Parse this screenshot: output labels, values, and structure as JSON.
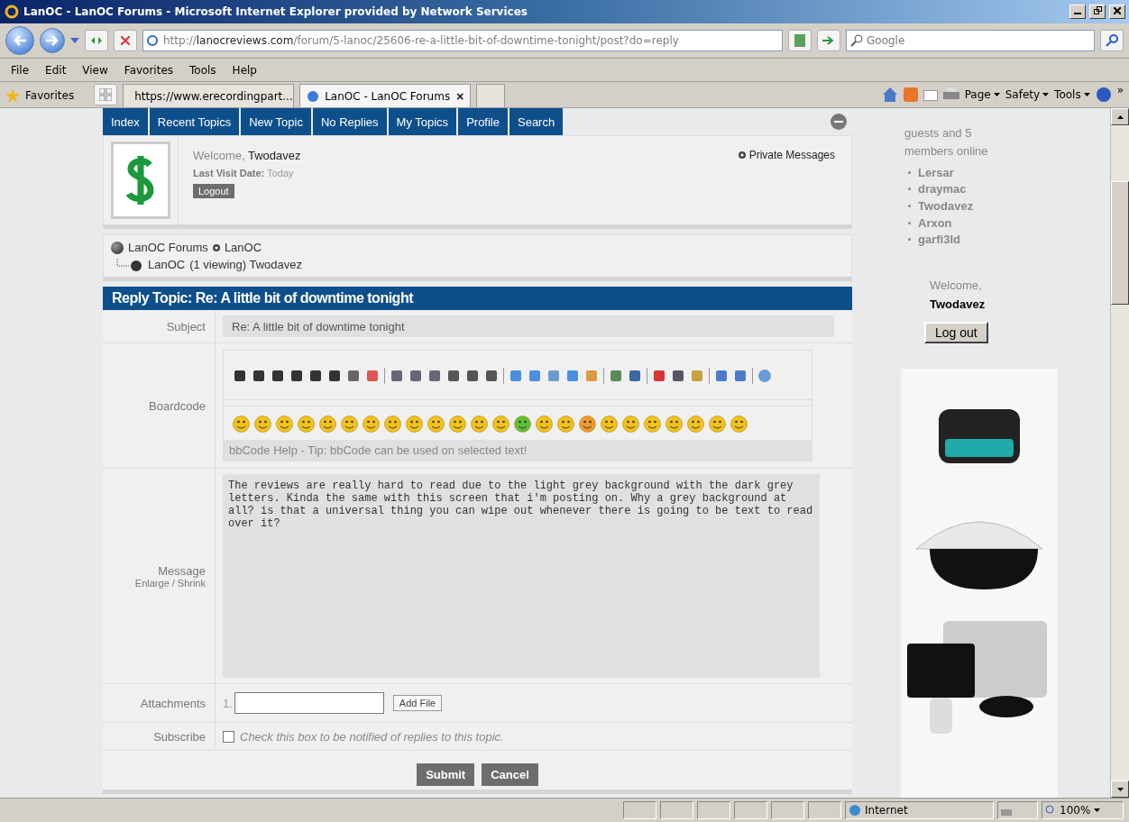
{
  "window": {
    "title": "LanOC - LanOC Forums - Microsoft Internet Explorer provided by Network Services"
  },
  "address_bar": {
    "url_prefix": "http://",
    "url_host": "lanocreviews.com",
    "url_path": "/forum/5-lanoc/25606-re-a-little-bit-of-downtime-tonight/post?do=reply",
    "search_placeholder": "Google"
  },
  "menu": [
    "File",
    "Edit",
    "View",
    "Favorites",
    "Tools",
    "Help"
  ],
  "favorites_bar": {
    "label": "Favorites",
    "tabs": [
      {
        "label": "https://www.erecordingpart...",
        "selected": false
      },
      {
        "label": "LanOC - LanOC Forums",
        "selected": true
      }
    ],
    "close": "×",
    "commands": [
      "Page",
      "Safety",
      "Tools"
    ],
    "more": "»"
  },
  "forum_nav": [
    {
      "label": "Index"
    },
    {
      "label": "Recent Topics"
    },
    {
      "label": "New Topic"
    },
    {
      "label": "No Replies"
    },
    {
      "label": "My Topics"
    },
    {
      "label": "Profile"
    },
    {
      "label": "Search"
    }
  ],
  "user_panel": {
    "welcome": "Welcome,",
    "user": "Twodavez",
    "last_visit_label": "Last Visit Date:",
    "last_visit": "Today",
    "logout": "Logout",
    "private_messages": "Private Messages"
  },
  "breadcrumb": {
    "root": "LanOC Forums",
    "section": "LanOC",
    "current": "LanOC",
    "viewing": "(1 viewing)",
    "viewer": "Twodavez"
  },
  "reply_form": {
    "title": "Reply Topic: Re: A little bit of downtime tonight",
    "subject_label": "Subject",
    "subject_value": "Re: A little bit of downtime tonight",
    "boardcode_label": "Boardcode",
    "help_tip": "bbCode Help - Tip: bbCode can be used on selected text!",
    "message_label": "Message",
    "enlarge": "Enlarge",
    "separator": "/",
    "shrink": "Shrink",
    "message_value": "The reviews are really hard to read due to the light grey background with the dark grey letters. Kinda the same with this screen that i'm posting on. Why a grey background at all? is that a universal thing you can wipe out whenever there is going to be text to read over it?",
    "attachments_label": "Attachments",
    "attachment_index": "1.",
    "add_file": "Add File",
    "subscribe_label": "Subscribe",
    "subscribe_checked": false,
    "subscribe_text": "Check this box to be notified of replies to this topic.",
    "buttons": [
      "Submit",
      "Cancel"
    ]
  },
  "sidebar": {
    "online_text": "guests and 5 members online",
    "members": [
      "Lersar",
      "draymac",
      "Twodavez",
      "Arxon",
      "garfi3ld"
    ],
    "welcome": "Welcome,",
    "user": "Twodavez",
    "logout": "Log out"
  },
  "status_bar": {
    "zone": "Internet",
    "zoom": "100%"
  }
}
